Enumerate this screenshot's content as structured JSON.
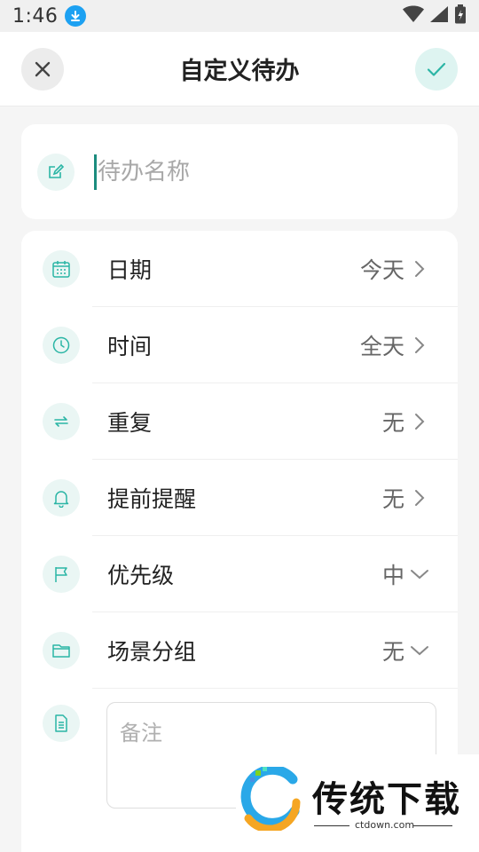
{
  "status_bar": {
    "time": "1:46"
  },
  "header": {
    "title": "自定义待办"
  },
  "name_field": {
    "placeholder": "待办名称",
    "value": ""
  },
  "rows": [
    {
      "label": "日期",
      "value": "今天",
      "arrow": "chevron-right"
    },
    {
      "label": "时间",
      "value": "全天",
      "arrow": "chevron-right"
    },
    {
      "label": "重复",
      "value": "无",
      "arrow": "chevron-right"
    },
    {
      "label": "提前提醒",
      "value": "无",
      "arrow": "chevron-right"
    },
    {
      "label": "优先级",
      "value": "中",
      "arrow": "chevron-down"
    },
    {
      "label": "场景分组",
      "value": "无",
      "arrow": "chevron-down"
    }
  ],
  "note_field": {
    "placeholder": "备注",
    "value": ""
  },
  "watermark": {
    "brand": "传统下载",
    "site": "ctdown.com"
  },
  "colors": {
    "accent": "#2bb5a5",
    "icon_bg": "#eaf6f4",
    "caret": "#1b8c7e"
  }
}
